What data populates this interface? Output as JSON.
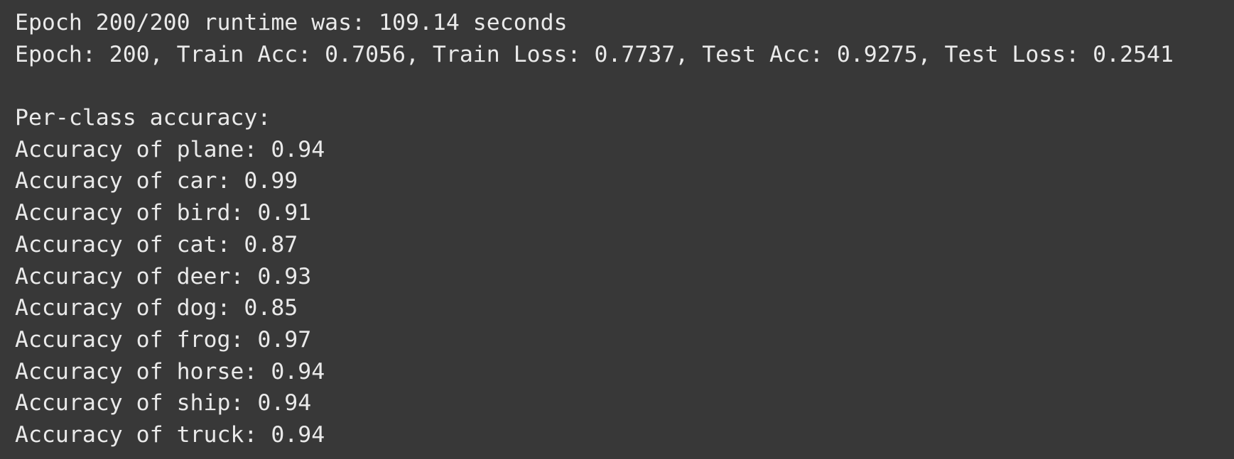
{
  "colors": {
    "background": "#383838",
    "text": "#eaeaea"
  },
  "output": {
    "lines": [
      "Epoch 200/200 runtime was: 109.14 seconds",
      "Epoch: 200, Train Acc: 0.7056, Train Loss: 0.7737, Test Acc: 0.9275, Test Loss: 0.2541",
      "",
      "Per-class accuracy:",
      "Accuracy of plane: 0.94",
      "Accuracy of car: 0.99",
      "Accuracy of bird: 0.91",
      "Accuracy of cat: 0.87",
      "Accuracy of deer: 0.93",
      "Accuracy of dog: 0.85",
      "Accuracy of frog: 0.97",
      "Accuracy of horse: 0.94",
      "Accuracy of ship: 0.94",
      "Accuracy of truck: 0.94"
    ]
  }
}
